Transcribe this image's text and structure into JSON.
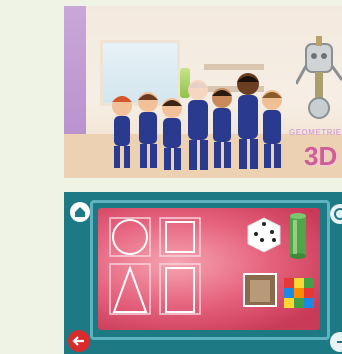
{
  "top_app": {
    "logo_small": "GEOMETRIE",
    "logo_main": "3D"
  },
  "bottom_app": {
    "shapes_2d": [
      "circle",
      "square",
      "triangle",
      "rectangle"
    ],
    "objects_3d": [
      "dice",
      "cylinder",
      "box",
      "rubiks-cube"
    ]
  },
  "colors": {
    "background": "#eef3e6",
    "screen_teal": "#1d7a85",
    "board_pink": "#e6637e",
    "back_red": "#d92b2b",
    "logo_pink": "#cf5e96"
  }
}
